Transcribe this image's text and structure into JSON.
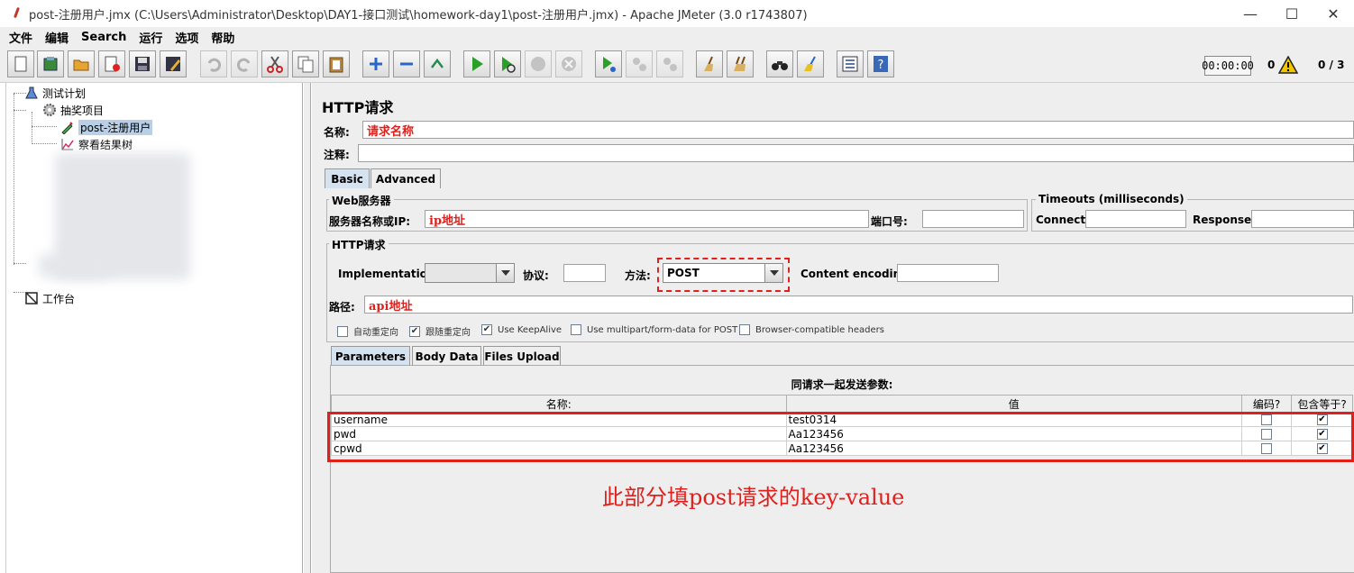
{
  "window": {
    "title": "post-注册用户.jmx (C:\\Users\\Administrator\\Desktop\\DAY1-接口测试\\homework-day1\\post-注册用户.jmx) - Apache JMeter (3.0 r1743807)",
    "minimize": "—",
    "maximize": "☐",
    "close": "✕"
  },
  "menu": [
    "文件",
    "编辑",
    "Search",
    "运行",
    "选项",
    "帮助"
  ],
  "toolbar": {
    "timer": "00:00:00",
    "error_count": "0",
    "threads": "0 / 3"
  },
  "tree": {
    "test_plan": "测试计划",
    "thread_group": "抽奖项目",
    "sampler": "post-注册用户",
    "listener": "察看结果树",
    "workbench": "工作台"
  },
  "editor": {
    "title": "HTTP请求",
    "name_label": "名称:",
    "name_value": "请求名称",
    "comment_label": "注释:",
    "tabs": [
      "Basic",
      "Advanced"
    ],
    "web_server_group": "Web服务器",
    "server_label": "服务器名称或IP:",
    "server_value": "ip地址",
    "port_label": "端口号:",
    "timeouts_group": "Timeouts (milliseconds)",
    "connect_label": "Connect:",
    "response_label": "Response:",
    "http_group": "HTTP请求",
    "implementation_label": "Implementation:",
    "protocol_label": "协议:",
    "method_label": "方法:",
    "method_value": "POST",
    "encoding_label": "Content encoding:",
    "path_label": "路径:",
    "path_value": "api地址",
    "checkboxes": [
      {
        "label": "自动重定向",
        "checked": false
      },
      {
        "label": "跟随重定向",
        "checked": true
      },
      {
        "label": "Use KeepAlive",
        "checked": true
      },
      {
        "label": "Use multipart/form-data for POST",
        "checked": false
      },
      {
        "label": "Browser-compatible headers",
        "checked": false
      }
    ],
    "param_tabs": [
      "Parameters",
      "Body Data",
      "Files Upload"
    ],
    "params_caption": "同请求一起发送参数:",
    "columns": [
      "名称:",
      "值",
      "编码?",
      "包含等于?"
    ],
    "rows": [
      {
        "name": "username",
        "value": "test0314",
        "encode": false,
        "include_equals": true
      },
      {
        "name": "pwd",
        "value": "Aa123456",
        "encode": false,
        "include_equals": true
      },
      {
        "name": "cpwd",
        "value": "Aa123456",
        "encode": false,
        "include_equals": true
      }
    ],
    "annotation": "此部分填post请求的key-value"
  },
  "colors": {
    "annotation_red": "#e0201c",
    "panel_bg": "#eeeeee",
    "selection": "#b8cfe5"
  }
}
